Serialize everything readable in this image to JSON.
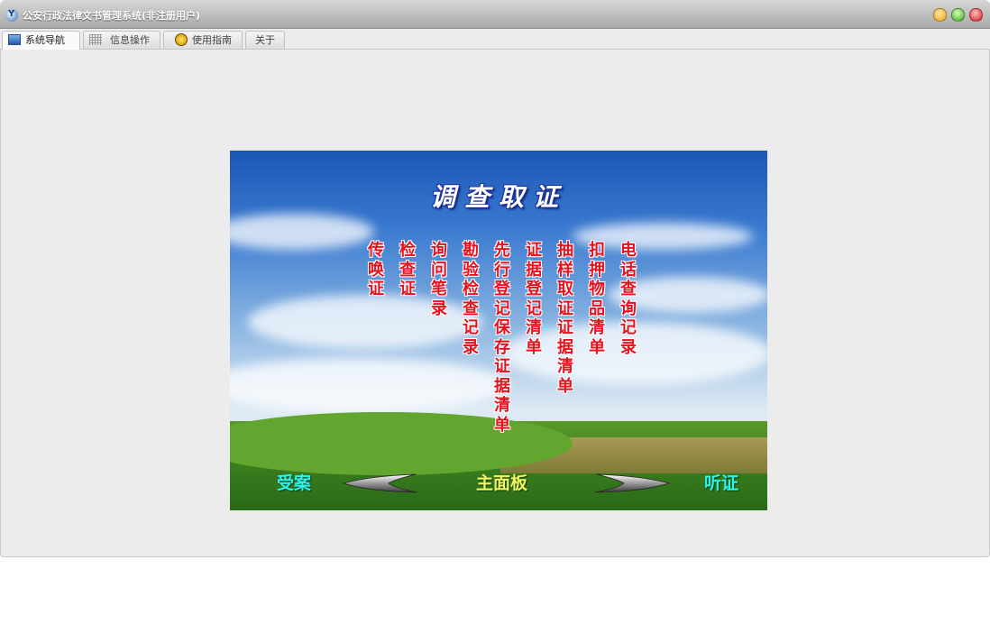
{
  "window": {
    "title": "公安行政法律文书管理系统(非注册用户)"
  },
  "tabs": [
    {
      "label": "系统导航",
      "icon": "monitor-icon",
      "active": true
    },
    {
      "label": "信息操作",
      "icon": "grid-icon",
      "active": false
    },
    {
      "label": "使用指南",
      "icon": "help-icon",
      "active": false
    },
    {
      "label": "关于",
      "icon": "",
      "active": false
    }
  ],
  "panel": {
    "title": "调查取证",
    "documents": [
      "传唤证",
      "检查证",
      "询问笔录",
      "勘验检查记录",
      "先行登记保存证据清单",
      "证据登记清单",
      "抽样取证证据清单",
      "扣押物品清单",
      "电话查询记录"
    ],
    "nav": {
      "prev_label": "受案",
      "home_label": "主面板",
      "next_label": "听证"
    }
  },
  "colors": {
    "document_text": "#e8121e",
    "nav_side": "#2ef3ec",
    "nav_home": "#f1f560"
  }
}
